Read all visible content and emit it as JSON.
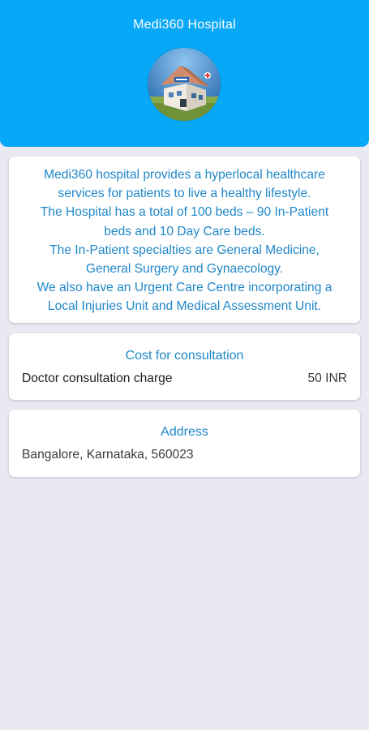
{
  "header": {
    "title": "Medi360 Hospital",
    "avatar_icon": "hospital-building-icon"
  },
  "about": {
    "text": "Medi360 hospital provides a hyperlocal healthcare\nservices for patients to live a healthy lifestyle.\nThe Hospital has a total of 100 beds – 90 In-Patient\nbeds and 10 Day Care beds.\nThe In-Patient specialties are General Medicine,\nGeneral Surgery and Gynaecology.\nWe also have an Urgent Care Centre incorporating a\nLocal Injuries Unit and Medical Assessment Unit."
  },
  "cost": {
    "heading": "Cost for consultation",
    "label": "Doctor consultation charge",
    "value": "50 INR"
  },
  "address": {
    "heading": "Address",
    "text": "Bangalore, Karnataka, 560023"
  },
  "colors": {
    "header": "#08a8f8",
    "accent_text": "#1f87c8",
    "background": "#e9e9f1",
    "card": "#ffffff"
  }
}
